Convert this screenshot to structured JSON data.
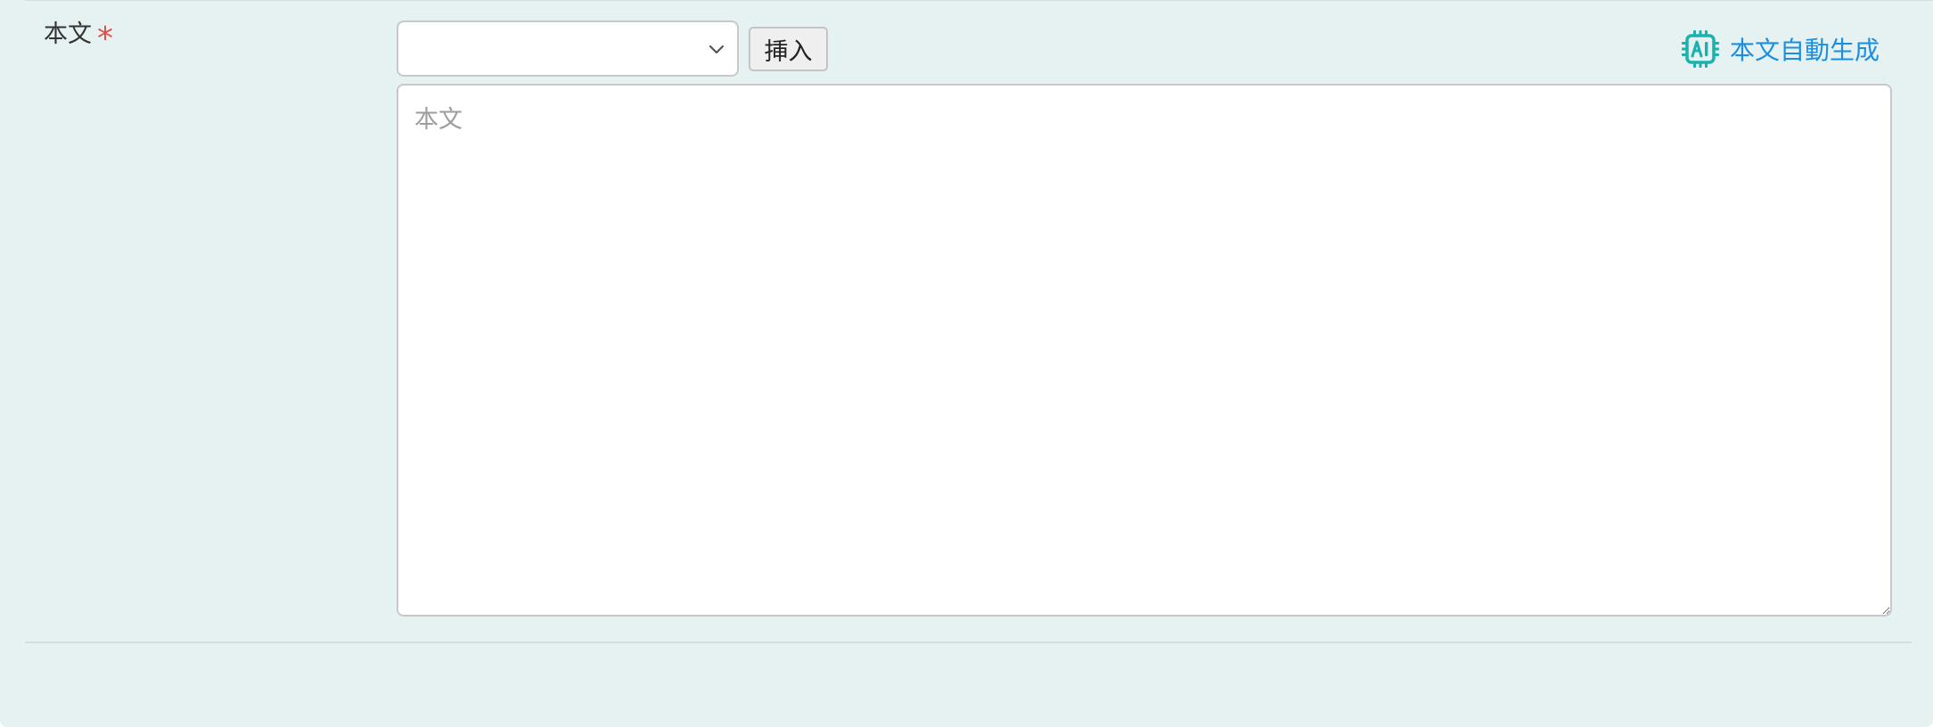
{
  "form": {
    "body_field": {
      "label": "本文",
      "required_mark": "*",
      "template_select": {
        "selected_value": ""
      },
      "insert_button_label": "挿入",
      "ai_generate_link_label": "本文自動生成",
      "ai_icon": "ai-chip-icon",
      "textarea": {
        "value": "",
        "placeholder": "本文"
      }
    }
  },
  "colors": {
    "panel_background": "#e6f1f1",
    "required": "#e0504b",
    "link": "#1a8fe0",
    "ai_icon": "#1bb1ad"
  }
}
